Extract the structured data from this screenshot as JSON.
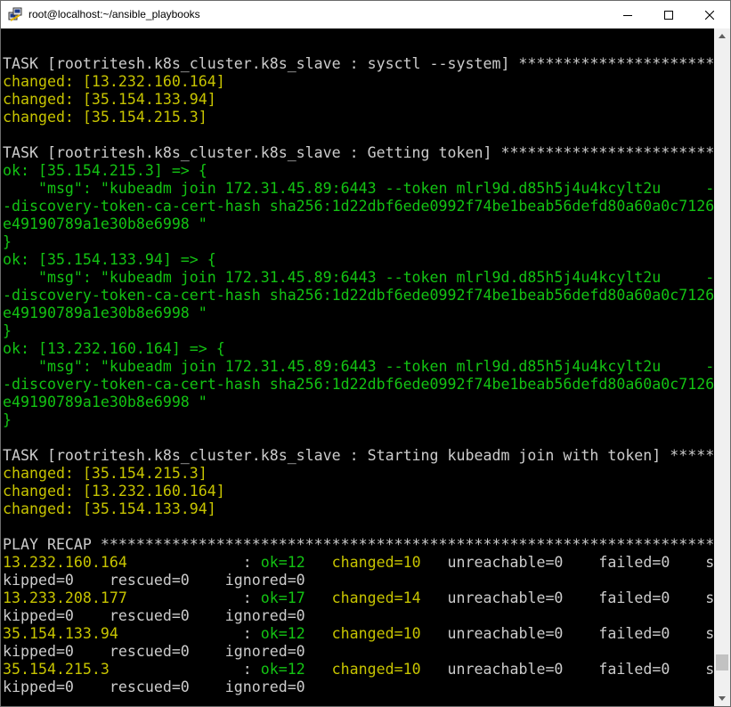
{
  "window": {
    "title": "root@localhost:~/ansible_playbooks",
    "icon": "putty-terminal-icon",
    "controls": [
      "minimize-icon",
      "maximize-icon",
      "close-icon"
    ]
  },
  "colors": {
    "background": "#000000",
    "text": "#c0c0c0",
    "changed": "#c7c400",
    "ok": "#13c313"
  },
  "terminal": {
    "lines": [
      {
        "segments": []
      },
      {
        "segments": [
          {
            "t": "TASK [rootritesh.k8s_cluster.k8s_slave : sysctl --system] ************************",
            "c": "w"
          }
        ]
      },
      {
        "segments": [
          {
            "t": "changed: [13.232.160.164]",
            "c": "y"
          }
        ]
      },
      {
        "segments": [
          {
            "t": "changed: [35.154.133.94]",
            "c": "y"
          }
        ]
      },
      {
        "segments": [
          {
            "t": "changed: [35.154.215.3]",
            "c": "y"
          }
        ]
      },
      {
        "segments": []
      },
      {
        "segments": [
          {
            "t": "TASK [rootritesh.k8s_cluster.k8s_slave : Getting token] **************************",
            "c": "w"
          }
        ]
      },
      {
        "segments": [
          {
            "t": "ok: [35.154.215.3] => {",
            "c": "g"
          }
        ]
      },
      {
        "segments": [
          {
            "t": "    \"msg\": \"kubeadm join 172.31.45.89:6443 --token mlrl9d.d85h5j4u4kcylt2u     -",
            "c": "g"
          }
        ]
      },
      {
        "segments": [
          {
            "t": "-discovery-token-ca-cert-hash sha256:1d22dbf6ede0992f74be1beab56defd80a60a0c7126",
            "c": "g"
          }
        ]
      },
      {
        "segments": [
          {
            "t": "e49190789a1e30b8e6998 \"",
            "c": "g"
          }
        ]
      },
      {
        "segments": [
          {
            "t": "}",
            "c": "g"
          }
        ]
      },
      {
        "segments": [
          {
            "t": "ok: [35.154.133.94] => {",
            "c": "g"
          }
        ]
      },
      {
        "segments": [
          {
            "t": "    \"msg\": \"kubeadm join 172.31.45.89:6443 --token mlrl9d.d85h5j4u4kcylt2u     -",
            "c": "g"
          }
        ]
      },
      {
        "segments": [
          {
            "t": "-discovery-token-ca-cert-hash sha256:1d22dbf6ede0992f74be1beab56defd80a60a0c7126",
            "c": "g"
          }
        ]
      },
      {
        "segments": [
          {
            "t": "e49190789a1e30b8e6998 \"",
            "c": "g"
          }
        ]
      },
      {
        "segments": [
          {
            "t": "}",
            "c": "g"
          }
        ]
      },
      {
        "segments": [
          {
            "t": "ok: [13.232.160.164] => {",
            "c": "g"
          }
        ]
      },
      {
        "segments": [
          {
            "t": "    \"msg\": \"kubeadm join 172.31.45.89:6443 --token mlrl9d.d85h5j4u4kcylt2u     -",
            "c": "g"
          }
        ]
      },
      {
        "segments": [
          {
            "t": "-discovery-token-ca-cert-hash sha256:1d22dbf6ede0992f74be1beab56defd80a60a0c7126",
            "c": "g"
          }
        ]
      },
      {
        "segments": [
          {
            "t": "e49190789a1e30b8e6998 \"",
            "c": "g"
          }
        ]
      },
      {
        "segments": [
          {
            "t": "}",
            "c": "g"
          }
        ]
      },
      {
        "segments": []
      },
      {
        "segments": [
          {
            "t": "TASK [rootritesh.k8s_cluster.k8s_slave : Starting kubeadm join with token] *****",
            "c": "w"
          }
        ]
      },
      {
        "segments": [
          {
            "t": "changed: [35.154.215.3]",
            "c": "y"
          }
        ]
      },
      {
        "segments": [
          {
            "t": "changed: [13.232.160.164]",
            "c": "y"
          }
        ]
      },
      {
        "segments": [
          {
            "t": "changed: [35.154.133.94]",
            "c": "y"
          }
        ]
      },
      {
        "segments": []
      },
      {
        "segments": [
          {
            "t": "PLAY RECAP *********************************************************************",
            "c": "w"
          }
        ]
      },
      {
        "segments": [
          {
            "t": "13.232.160.164",
            "c": "y"
          },
          {
            "t": "             : ",
            "c": "w"
          },
          {
            "t": "ok=12",
            "c": "g"
          },
          {
            "t": "   ",
            "c": "w"
          },
          {
            "t": "changed=10",
            "c": "y"
          },
          {
            "t": "   unreachable=0    failed=0    s",
            "c": "w"
          }
        ]
      },
      {
        "segments": [
          {
            "t": "kipped=0    rescued=0    ignored=0",
            "c": "w"
          }
        ]
      },
      {
        "segments": [
          {
            "t": "13.233.208.177",
            "c": "y"
          },
          {
            "t": "             : ",
            "c": "w"
          },
          {
            "t": "ok=17",
            "c": "g"
          },
          {
            "t": "   ",
            "c": "w"
          },
          {
            "t": "changed=14",
            "c": "y"
          },
          {
            "t": "   unreachable=0    failed=0    s",
            "c": "w"
          }
        ]
      },
      {
        "segments": [
          {
            "t": "kipped=0    rescued=0    ignored=0",
            "c": "w"
          }
        ]
      },
      {
        "segments": [
          {
            "t": "35.154.133.94",
            "c": "y"
          },
          {
            "t": "              : ",
            "c": "w"
          },
          {
            "t": "ok=12",
            "c": "g"
          },
          {
            "t": "   ",
            "c": "w"
          },
          {
            "t": "changed=10",
            "c": "y"
          },
          {
            "t": "   unreachable=0    failed=0    s",
            "c": "w"
          }
        ]
      },
      {
        "segments": [
          {
            "t": "kipped=0    rescued=0    ignored=0",
            "c": "w"
          }
        ]
      },
      {
        "segments": [
          {
            "t": "35.154.215.3",
            "c": "y"
          },
          {
            "t": "               : ",
            "c": "w"
          },
          {
            "t": "ok=12",
            "c": "g"
          },
          {
            "t": "   ",
            "c": "w"
          },
          {
            "t": "changed=10",
            "c": "y"
          },
          {
            "t": "   unreachable=0    failed=0    s",
            "c": "w"
          }
        ]
      },
      {
        "segments": [
          {
            "t": "kipped=0    rescued=0    ignored=0",
            "c": "w"
          }
        ]
      }
    ]
  }
}
